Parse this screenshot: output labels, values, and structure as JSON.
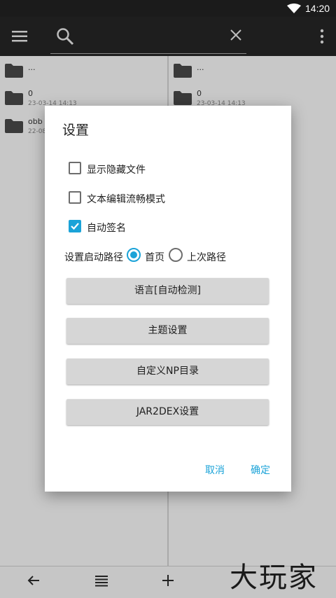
{
  "status": {
    "time": "14:20",
    "wifi_icon": "wifi-icon"
  },
  "toolbar": {
    "menu_icon": "menu-icon",
    "search_icon": "search-icon",
    "clear_icon": "close-icon",
    "more_icon": "more-vert-icon"
  },
  "left_pane": {
    "items": [
      {
        "name": "...",
        "date": ""
      },
      {
        "name": "0",
        "date": "23-03-14 14:13"
      },
      {
        "name": "obb",
        "date": "22-08"
      }
    ]
  },
  "right_pane": {
    "items": [
      {
        "name": "...",
        "date": ""
      },
      {
        "name": "0",
        "date": "23-03-14 14:13"
      }
    ]
  },
  "dialog": {
    "title": "设置",
    "options": [
      {
        "label": "显示隐藏文件",
        "checked": false
      },
      {
        "label": "文本编辑流畅模式",
        "checked": false
      },
      {
        "label": "自动签名",
        "checked": true
      }
    ],
    "start_path": {
      "label": "设置启动路径",
      "choices": [
        {
          "label": "首页",
          "selected": true
        },
        {
          "label": "上次路径",
          "selected": false
        }
      ]
    },
    "buttons": [
      "语言[自动检测]",
      "主题设置",
      "自定义NP目录",
      "JAR2DEX设置"
    ],
    "cancel": "取消",
    "confirm": "确定"
  },
  "bottombar": {
    "back_icon": "arrow-left-icon",
    "list_icon": "list-icon",
    "add_icon": "plus-icon"
  },
  "watermark": "大玩家",
  "colors": {
    "accent": "#1ba3d8",
    "toolbar": "#1e1e1e",
    "dialog_button": "#d6d6d6"
  }
}
